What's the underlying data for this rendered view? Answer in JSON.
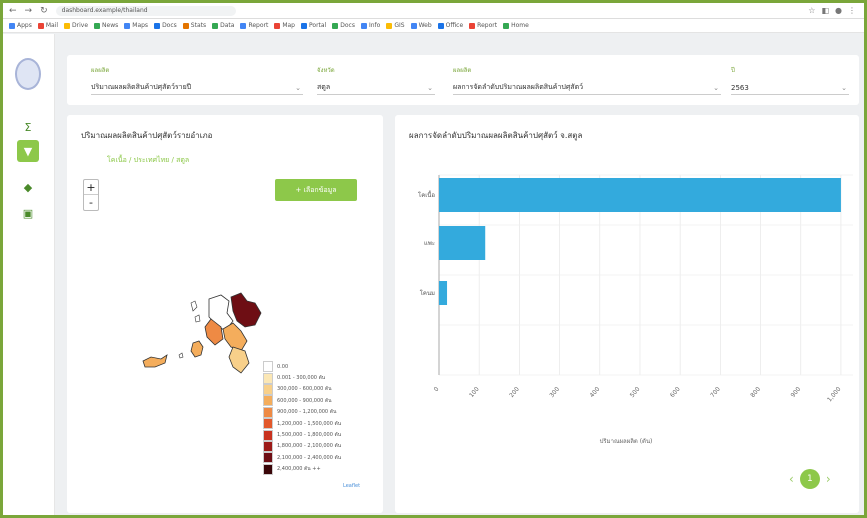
{
  "browser": {
    "url": "dashboard.example/thailand",
    "nav_back": "←",
    "nav_forward": "→",
    "nav_reload": "↻",
    "bookmarks": [
      {
        "label": "Apps",
        "color": "#4285f4"
      },
      {
        "label": "Mail",
        "color": "#ea4335"
      },
      {
        "label": "Drive",
        "color": "#fbbc05"
      },
      {
        "label": "News",
        "color": "#34a853"
      },
      {
        "label": "Maps",
        "color": "#4285f4"
      },
      {
        "label": "Docs",
        "color": "#1a73e8"
      },
      {
        "label": "Stats",
        "color": "#e37400"
      },
      {
        "label": "Data",
        "color": "#34a853"
      },
      {
        "label": "Report",
        "color": "#4285f4"
      },
      {
        "label": "Map",
        "color": "#ea4335"
      },
      {
        "label": "Portal",
        "color": "#1a73e8"
      },
      {
        "label": "Docs",
        "color": "#34a853"
      },
      {
        "label": "Info",
        "color": "#4285f4"
      },
      {
        "label": "GIS",
        "color": "#fbbc05"
      },
      {
        "label": "Web",
        "color": "#4285f4"
      },
      {
        "label": "Office",
        "color": "#1a73e8"
      },
      {
        "label": "Report",
        "color": "#ea4335"
      },
      {
        "label": "Home",
        "color": "#34a853"
      }
    ]
  },
  "sidebar": {
    "items": [
      {
        "icon": "chart-icon",
        "glyph": "Σ"
      },
      {
        "icon": "filter-icon",
        "glyph": "▼",
        "active": true
      },
      {
        "icon": "map-icon",
        "glyph": "◆"
      },
      {
        "icon": "table-icon",
        "glyph": "▣"
      }
    ]
  },
  "filters": {
    "f1": {
      "label": "ผลผลิต",
      "value": "ปริมาณผลผลิตสินค้าปศุสัตว์รายปี"
    },
    "f2": {
      "label": "จังหวัด",
      "value": "สตูล"
    },
    "f3": {
      "label": "ผลผลิต",
      "value": "ผลการจัดลำดับปริมาณผลผลิตสินค้าปศุสัตว์"
    },
    "f4": {
      "label": "ปี",
      "value": "2563"
    }
  },
  "map_card": {
    "title": "ปริมาณผลผลิตสินค้าปศุสัตว์รายอำเภอ",
    "crumb": "โคเนื้อ  /  ประเทศไทย  /  สตูล",
    "zoom_in": "+",
    "zoom_out": "-",
    "button": "+  เลือกข้อมูล",
    "legend": [
      {
        "label": "0.00",
        "color": "#ffffff"
      },
      {
        "label": "0.001 - 300,000 ตัน",
        "color": "#fbe7b5"
      },
      {
        "label": "300,000 - 600,000 ตัน",
        "color": "#f8d08a"
      },
      {
        "label": "600,000 - 900,000 ตัน",
        "color": "#f4ad5c"
      },
      {
        "label": "900,000 - 1,200,000 ตัน",
        "color": "#ee8a44"
      },
      {
        "label": "1,200,000 - 1,500,000 ตัน",
        "color": "#e2582b"
      },
      {
        "label": "1,500,000 - 1,800,000 ตัน",
        "color": "#c8321f"
      },
      {
        "label": "1,800,000 - 2,100,000 ตัน",
        "color": "#9c1a18"
      },
      {
        "label": "2,100,000 - 2,400,000 ตัน",
        "color": "#6e0e14"
      },
      {
        "label": "2,400,000 ตัน ++",
        "color": "#3a0609"
      }
    ],
    "corner_link": "Leaflet"
  },
  "chart_card": {
    "title": "ผลการจัดลำดับปริมาณผลผลิตสินค้าปศุสัตว์ จ.สตูล",
    "x_title": "ปริมาณผลผลิต (ตัน)",
    "page": "1",
    "prev": "‹",
    "next": "›"
  },
  "chart_data": {
    "type": "bar",
    "orientation": "horizontal",
    "categories": [
      "โคเนื้อ",
      "แพะ",
      "โคนม"
    ],
    "values": [
      1000,
      115,
      20
    ],
    "xlim": [
      0,
      1030
    ],
    "x_ticks": [
      "0",
      "100",
      "200",
      "300",
      "400",
      "500",
      "600",
      "700",
      "800",
      "900",
      "1,000"
    ],
    "xlabel": "ปริมาณผลผลิต (ตัน)",
    "grid": true,
    "bar_color": "#33aadd"
  }
}
